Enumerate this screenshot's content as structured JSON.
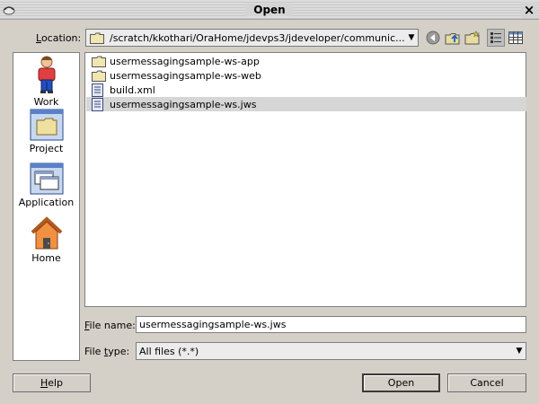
{
  "window": {
    "title": "Open",
    "close_glyph": "×"
  },
  "location": {
    "label_prefix": "",
    "label_mnemonic": "L",
    "label_rest": "ocation:",
    "path": "/scratch/kkothari/OraHome/jdevps3/jdeveloper/communic..."
  },
  "toolbar": {
    "buttons": [
      "back-icon",
      "up-folder-icon",
      "new-folder-icon",
      "list-view-icon",
      "details-view-icon"
    ],
    "pressed": "list-view-icon"
  },
  "places": [
    {
      "label": "Work",
      "icon": "work-person-icon"
    },
    {
      "label": "Project",
      "icon": "project-icon"
    },
    {
      "label": "Application",
      "icon": "application-icon"
    },
    {
      "label": "Home",
      "icon": "home-icon"
    }
  ],
  "files": [
    {
      "name": "usermessagingsample-ws-app",
      "type": "folder",
      "selected": false
    },
    {
      "name": "usermessagingsample-ws-web",
      "type": "folder",
      "selected": false
    },
    {
      "name": "build.xml",
      "type": "file",
      "selected": false
    },
    {
      "name": "usermessagingsample-ws.jws",
      "type": "file",
      "selected": true
    }
  ],
  "file_name": {
    "label_mnemonic": "F",
    "label_rest": "ile name:",
    "value": "usermessagingsample-ws.jws"
  },
  "file_type": {
    "label_prefix": "File ",
    "label_mnemonic": "t",
    "label_rest": "ype:",
    "value": "All files (*.*)"
  },
  "buttons": {
    "help_mnemonic": "H",
    "help_rest": "elp",
    "open": "Open",
    "cancel": "Cancel"
  }
}
